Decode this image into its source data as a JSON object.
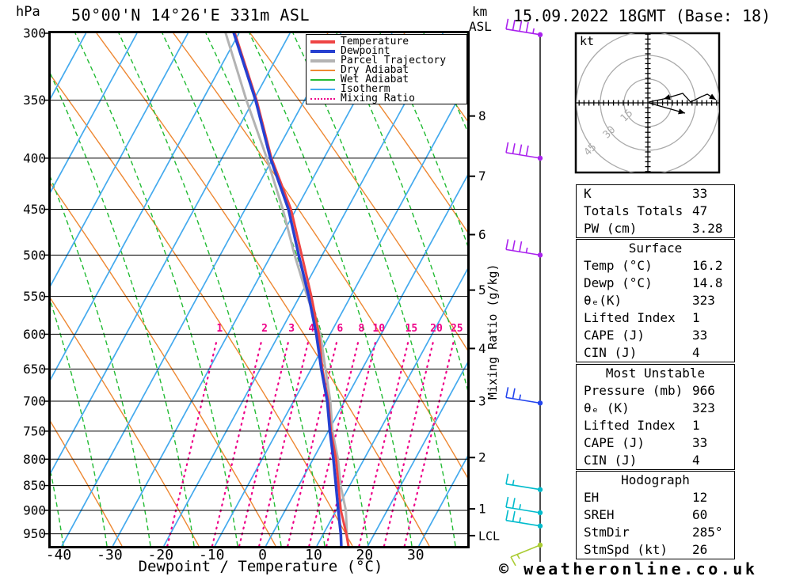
{
  "header": {
    "pressure_unit": "hPa",
    "title": "50°00'N 14°26'E 331m ASL",
    "altitude_unit_line1": "km",
    "altitude_unit_line2": "ASL",
    "date_title": "15.09.2022 18GMT (Base: 18)"
  },
  "legend": {
    "items": [
      {
        "label": "Temperature",
        "color": "#ee4444",
        "thick": true,
        "dash": "solid"
      },
      {
        "label": "Dewpoint",
        "color": "#2640d0",
        "thick": true,
        "dash": "solid"
      },
      {
        "label": "Parcel Trajectory",
        "color": "#b3b3b3",
        "thick": true,
        "dash": "solid"
      },
      {
        "label": "Dry Adiabat",
        "color": "#ee8833",
        "thick": false,
        "dash": "solid"
      },
      {
        "label": "Wet Adiabat",
        "color": "#22bb33",
        "thick": false,
        "dash": "solid"
      },
      {
        "label": "Isotherm",
        "color": "#44aaee",
        "thick": false,
        "dash": "solid"
      },
      {
        "label": "Mixing Ratio",
        "color": "#ee0088",
        "thick": false,
        "dash": "dotted"
      }
    ]
  },
  "chart_data": {
    "type": "skewt",
    "title": "50°00'N 14°26'E 331m ASL",
    "xlabel": "Dewpoint / Temperature (°C)",
    "ylabel_left": "hPa",
    "ylabel_right": "Mixing Ratio (g/kg)",
    "pressure_ticks": [
      300,
      350,
      400,
      450,
      500,
      550,
      600,
      650,
      700,
      750,
      800,
      850,
      900,
      950
    ],
    "temp_ticks": [
      -40,
      -30,
      -20,
      -10,
      0,
      10,
      20,
      30
    ],
    "altitude_ticks": [
      {
        "label": "8",
        "pressure": 363
      },
      {
        "label": "7",
        "pressure": 417
      },
      {
        "label": "6",
        "pressure": 477
      },
      {
        "label": "5",
        "pressure": 542
      },
      {
        "label": "4",
        "pressure": 620
      },
      {
        "label": "3",
        "pressure": 700
      },
      {
        "label": "2",
        "pressure": 797
      },
      {
        "label": "1",
        "pressure": 897
      },
      {
        "label": "LCL",
        "pressure": 954
      }
    ],
    "mixing_ratio_labels": [
      "1",
      "2",
      "3",
      "4",
      "6",
      "8",
      "10",
      "15",
      "20",
      "25"
    ],
    "mixing_ratio_line_temps": [
      -19.3,
      -10.5,
      -5.2,
      -1.3,
      4.3,
      8.5,
      11.9,
      18.3,
      23.2,
      27.2
    ],
    "sounding": {
      "pressure": [
        977,
        950,
        900,
        850,
        800,
        750,
        700,
        650,
        600,
        550,
        500,
        450,
        400,
        350,
        300
      ],
      "temperature": [
        16.2,
        14.5,
        10.9,
        7.8,
        4.5,
        0.5,
        -3.2,
        -7.8,
        -12.2,
        -17.7,
        -24.0,
        -31.0,
        -40.3,
        -49.4,
        -60.8
      ],
      "dewpoint": [
        14.8,
        13.4,
        10.4,
        7.3,
        4.0,
        0.3,
        -3.4,
        -8.0,
        -12.7,
        -18.2,
        -24.6,
        -31.5,
        -40.5,
        -49.6,
        -61.0
      ],
      "parcel": [
        16.2,
        14.6,
        11.9,
        8.2,
        4.9,
        0.8,
        -2.8,
        -7.2,
        -11.9,
        -18.5,
        -25.4,
        -32.6,
        -41.2,
        -51.4,
        -62.6
      ]
    },
    "winds": [
      {
        "pressure": 301,
        "speed_kt": 45,
        "color": "#aa22ee"
      },
      {
        "pressure": 400,
        "speed_kt": 40,
        "color": "#aa22ee"
      },
      {
        "pressure": 500,
        "speed_kt": 35,
        "color": "#aa22ee"
      },
      {
        "pressure": 703,
        "speed_kt": 25,
        "color": "#2244ee"
      },
      {
        "pressure": 858,
        "speed_kt": 15,
        "color": "#00bbcc"
      },
      {
        "pressure": 905,
        "speed_kt": 25,
        "color": "#00bbcc"
      },
      {
        "pressure": 933,
        "speed_kt": 25,
        "color": "#00bbcc"
      },
      {
        "pressure": 975,
        "speed_kt": 15,
        "color": "#aacc33",
        "surface": true
      }
    ],
    "line_colors": {
      "temperature": "#ee4444",
      "dewpoint": "#2640d0",
      "parcel": "#b3b3b3",
      "dry_adiabat": "#ee8833",
      "wet_adiabat": "#22bb33",
      "isotherm": "#44aaee",
      "mixing_ratio": "#ee0088"
    }
  },
  "hodograph": {
    "unit_label": "kt",
    "rings_kt": [
      15,
      30,
      45
    ],
    "ring_labels": [
      "15",
      "30",
      "45"
    ],
    "trace_kt": [
      [
        0.5,
        0.5
      ],
      [
        10,
        2.5
      ],
      [
        22,
        6
      ],
      [
        27,
        0.5
      ],
      [
        34,
        4
      ],
      [
        37.5,
        5.5
      ],
      [
        43,
        2
      ]
    ],
    "inflow_arrow_index": 1,
    "storm_motion_kt": [
      23.5,
      -6.5
    ],
    "storm_dir_deg": 285,
    "storm_speed_kt": 26
  },
  "tables": [
    {
      "rows": [
        [
          "K",
          "33"
        ],
        [
          "Totals Totals",
          "47"
        ],
        [
          "PW (cm)",
          "3.28"
        ]
      ]
    },
    {
      "title": "Surface",
      "rows": [
        [
          "Temp (°C)",
          "16.2"
        ],
        [
          "Dewp (°C)",
          "14.8"
        ],
        [
          "θₑ(K)",
          "323"
        ],
        [
          "Lifted Index",
          "1"
        ],
        [
          "CAPE (J)",
          "33"
        ],
        [
          "CIN (J)",
          "4"
        ]
      ]
    },
    {
      "title": "Most Unstable",
      "rows": [
        [
          "Pressure (mb)",
          "966"
        ],
        [
          "θₑ (K)",
          "323"
        ],
        [
          "Lifted Index",
          "1"
        ],
        [
          "CAPE (J)",
          "33"
        ],
        [
          "CIN (J)",
          "4"
        ]
      ]
    },
    {
      "title": "Hodograph",
      "rows": [
        [
          "EH",
          "12"
        ],
        [
          "SREH",
          "60"
        ],
        [
          "StmDir",
          "285°"
        ],
        [
          "StmSpd (kt)",
          "26"
        ]
      ]
    }
  ],
  "footer": {
    "copyright": "© weatheronline.co.uk"
  }
}
